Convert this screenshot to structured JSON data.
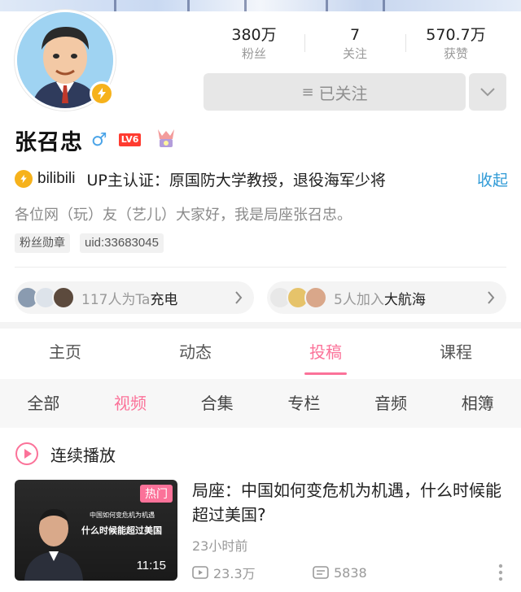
{
  "profile": {
    "followers_value": "380万",
    "followers_label": "粉丝",
    "following_value": "7",
    "following_label": "关注",
    "likes_value": "570.7万",
    "likes_label": "获赞",
    "follow_button": "已关注",
    "username": "张召忠",
    "gender_symbol": "♂",
    "level_badge": "LV6",
    "cert_brand": "bilibili",
    "cert_text": "UP主认证：原国防大学教授，退役海军少将",
    "expand_link": "收起",
    "bio": "各位网（玩）友（艺儿）大家好，我是局座张召忠。",
    "tags": [
      "粉丝勋章",
      "uid:33683045"
    ]
  },
  "charge": {
    "muted": "117人为Ta",
    "strong": "充电"
  },
  "crew": {
    "muted": "5人加入",
    "strong": "大航海"
  },
  "main_tabs": [
    "主页",
    "动态",
    "投稿",
    "课程"
  ],
  "main_tab_active": "投稿",
  "sub_tabs": [
    "全部",
    "视频",
    "合集",
    "专栏",
    "音频",
    "相簿"
  ],
  "sub_tab_active": "视频",
  "autoplay_label": "连续播放",
  "video": {
    "hot_badge": "热门",
    "thumb_line1": "中国如何变危机为机遇",
    "thumb_line2": "什么时候能超过美国",
    "duration": "11:15",
    "title": "局座：中国如何变危机为机遇，什么时候能超过美国?",
    "time_ago": "23小时前",
    "views": "23.3万",
    "danmaku": "5838"
  },
  "colors": {
    "accent": "#fb7299",
    "link": "#2f9ad6",
    "verified": "#f6b21c"
  }
}
